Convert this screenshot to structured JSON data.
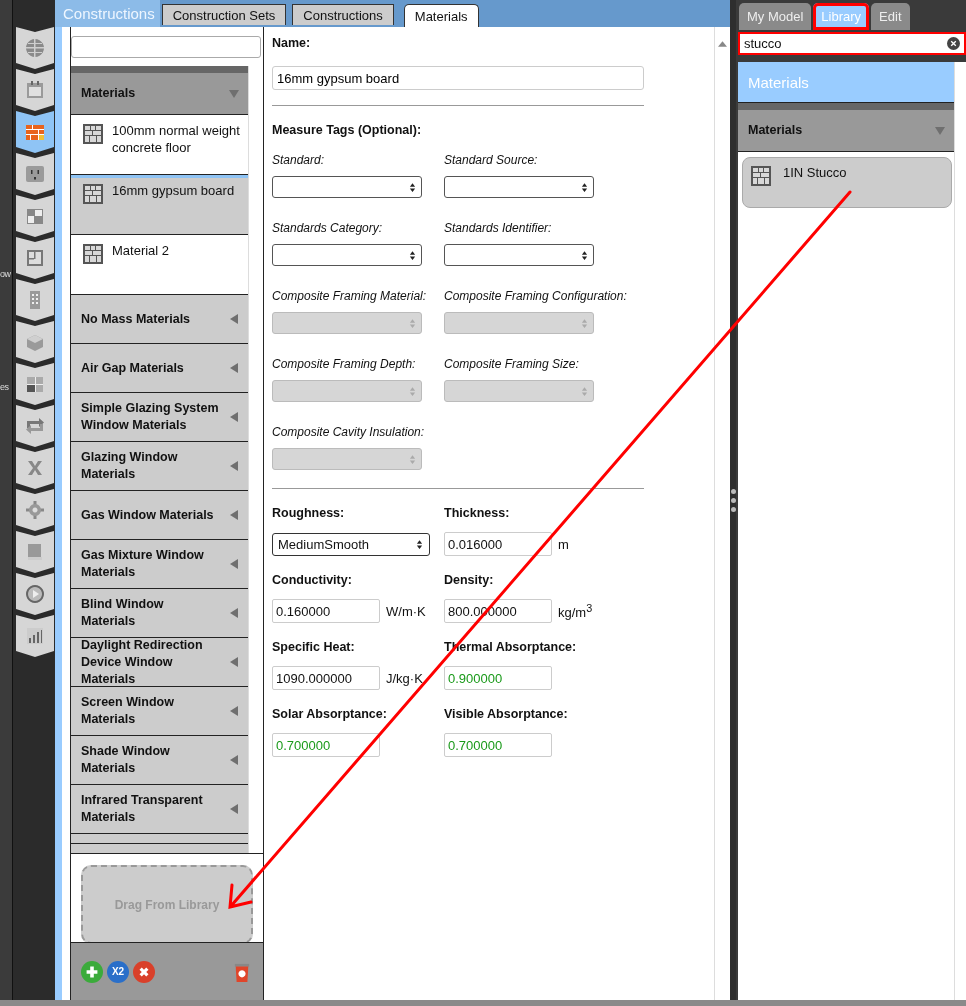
{
  "left_edge_texts": [
    "ow",
    "es"
  ],
  "nav_icons": [
    {
      "kind": "globe",
      "selected": false
    },
    {
      "kind": "calendar",
      "selected": false
    },
    {
      "kind": "bricks",
      "selected": true
    },
    {
      "kind": "outlet",
      "selected": false
    },
    {
      "kind": "blocks",
      "selected": false
    },
    {
      "kind": "floorplan",
      "selected": false
    },
    {
      "kind": "building",
      "selected": false
    },
    {
      "kind": "box",
      "selected": false
    },
    {
      "kind": "cubes",
      "selected": false
    },
    {
      "kind": "loop",
      "selected": false
    },
    {
      "kind": "variable",
      "selected": false
    },
    {
      "kind": "gear",
      "selected": false
    },
    {
      "kind": "scroll",
      "selected": false
    },
    {
      "kind": "play",
      "selected": false
    },
    {
      "kind": "chart",
      "selected": false
    }
  ],
  "main": {
    "title": "Constructions",
    "tabs": [
      {
        "label": "Construction Sets",
        "selected": false
      },
      {
        "label": "Constructions",
        "selected": false
      },
      {
        "label": "Materials",
        "selected": true
      }
    ]
  },
  "list": {
    "sections": [
      {
        "label": "Materials",
        "expanded": true,
        "items": [
          {
            "name": "100mm normal weight concrete floor",
            "selected": false
          },
          {
            "name": "16mm gypsum board",
            "selected": true
          },
          {
            "name": "Material 2",
            "selected": false
          }
        ]
      },
      {
        "label": "No Mass Materials",
        "expanded": false
      },
      {
        "label": "Air Gap Materials",
        "expanded": false
      },
      {
        "label": "Simple Glazing System Window Materials",
        "expanded": false
      },
      {
        "label": "Glazing Window Materials",
        "expanded": false
      },
      {
        "label": "Gas Window Materials",
        "expanded": false
      },
      {
        "label": "Gas Mixture Window Materials",
        "expanded": false
      },
      {
        "label": "Blind Window Materials",
        "expanded": false
      },
      {
        "label": "Daylight Redirection Device Window Materials",
        "expanded": false
      },
      {
        "label": "Screen Window Materials",
        "expanded": false
      },
      {
        "label": "Shade Window Materials",
        "expanded": false
      },
      {
        "label": "Infrared Transparent Materials",
        "expanded": false
      }
    ],
    "drop_zone": "Drag From Library",
    "footer_buttons": [
      {
        "kind": "add"
      },
      {
        "kind": "copy",
        "label": "X2"
      },
      {
        "kind": "remove"
      },
      {
        "kind": "purge"
      }
    ]
  },
  "form": {
    "name_label": "Name:",
    "name_value": "16mm gypsum board",
    "tags_title": "Measure Tags (Optional):",
    "tags": [
      {
        "label": "Standard:",
        "disabled": false
      },
      {
        "label": "Standard Source:",
        "disabled": false
      },
      {
        "label": "Standards Category:",
        "disabled": false
      },
      {
        "label": "Standards Identifier:",
        "disabled": false
      },
      {
        "label": "Composite Framing Material:",
        "disabled": true
      },
      {
        "label": "Composite Framing Configuration:",
        "disabled": true
      },
      {
        "label": "Composite Framing Depth:",
        "disabled": true
      },
      {
        "label": "Composite Framing Size:",
        "disabled": true
      },
      {
        "label": "Composite Cavity Insulation:",
        "disabled": true
      }
    ],
    "properties": [
      {
        "label": "Roughness:",
        "kind": "select",
        "value": "MediumSmooth"
      },
      {
        "label": "Thickness:",
        "kind": "input",
        "value": "0.016000",
        "unit": "m",
        "defaulted": false
      },
      {
        "label": "Conductivity:",
        "kind": "input",
        "value": "0.160000",
        "unit": "W/m·K",
        "defaulted": false
      },
      {
        "label": "Density:",
        "kind": "input",
        "value": "800.000000",
        "unit": "kg/m$^{3}$",
        "defaulted": false
      },
      {
        "label": "Specific Heat:",
        "kind": "input",
        "value": "1090.000000",
        "unit": "J/kg·K",
        "defaulted": false
      },
      {
        "label": "Thermal Absorptance:",
        "kind": "input",
        "value": "0.900000",
        "defaulted": true
      },
      {
        "label": "Solar Absorptance:",
        "kind": "input",
        "value": "0.700000",
        "defaulted": true
      },
      {
        "label": "Visible Absorptance:",
        "kind": "input",
        "value": "0.700000",
        "defaulted": true
      }
    ]
  },
  "library": {
    "tabs": [
      {
        "label": "My Model",
        "selected": false,
        "highlighted": false
      },
      {
        "label": "Library",
        "selected": true,
        "highlighted": true
      },
      {
        "label": "Edit",
        "selected": false,
        "highlighted": false
      }
    ],
    "search": {
      "value": "stucco",
      "highlighted": true
    },
    "header": "Materials",
    "section": {
      "label": "Materials",
      "expanded": true
    },
    "items": [
      {
        "name": "1IN Stucco"
      }
    ]
  }
}
